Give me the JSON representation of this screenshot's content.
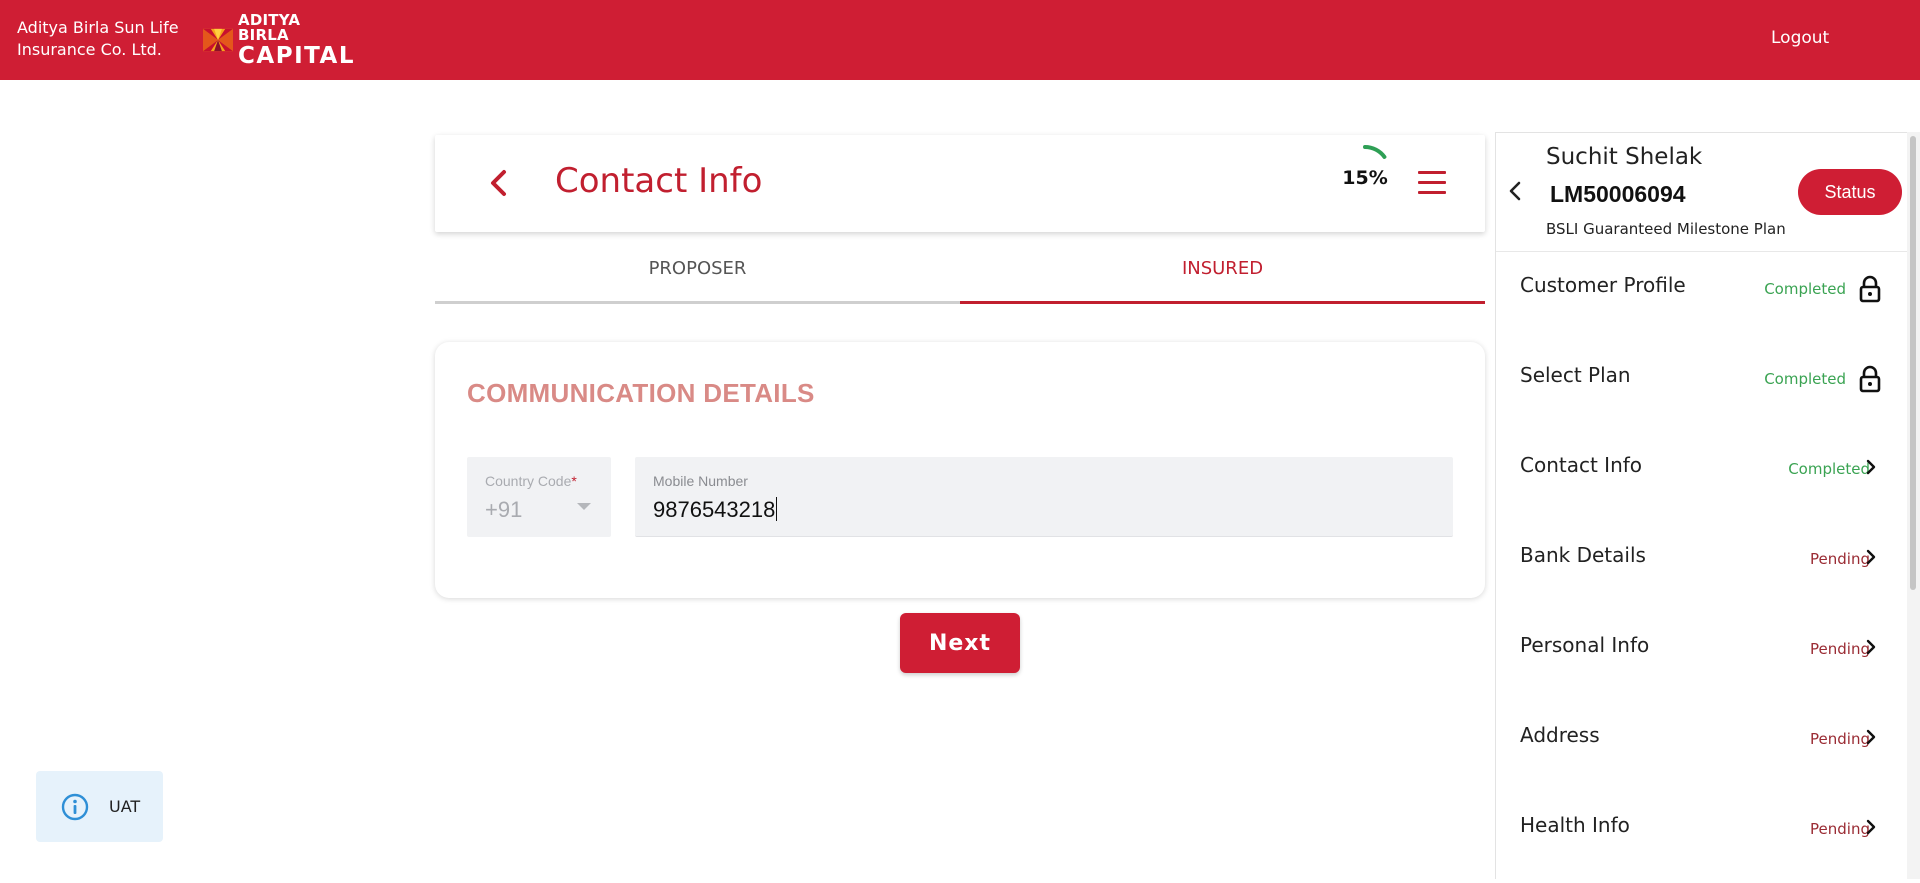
{
  "header": {
    "brand_line1": "Aditya Birla Sun Life",
    "brand_line2": "Insurance Co. Ltd.",
    "logo_line1": "ADITYA BIRLA",
    "logo_line2": "CAPITAL",
    "logout_label": "Logout",
    "bg_color": "#cf1e34"
  },
  "page": {
    "title": "Contact Info",
    "progress_text": "15%",
    "progress_fraction": 0.15
  },
  "tabs": [
    {
      "label": "PROPOSER",
      "active": false
    },
    {
      "label": "INSURED",
      "active": true
    }
  ],
  "communication": {
    "title": "COMMUNICATION DETAILS",
    "country_code_label": "Country Code",
    "country_code_required": "*",
    "country_code_value": "+91",
    "mobile_label": "Mobile Number",
    "mobile_value": "9876543218"
  },
  "next_label": "Next",
  "env_badge": {
    "icon": "info-icon",
    "text": "UAT"
  },
  "customer": {
    "name": "Suchit Shelak",
    "id": "LM50006094",
    "plan": "BSLI Guaranteed Milestone Plan",
    "status_label": "Status"
  },
  "steps": [
    {
      "label": "Customer Profile",
      "status": "Completed",
      "icon": "lock-icon"
    },
    {
      "label": "Select Plan",
      "status": "Completed",
      "icon": "lock-icon"
    },
    {
      "label": "Contact Info",
      "status": "Completed",
      "icon": "chevron-right-icon"
    },
    {
      "label": "Bank Details",
      "status": "Pending",
      "icon": "chevron-right-icon"
    },
    {
      "label": "Personal Info",
      "status": "Pending",
      "icon": "chevron-right-icon"
    },
    {
      "label": "Address",
      "status": "Pending",
      "icon": "chevron-right-icon"
    },
    {
      "label": "Health Info",
      "status": "Pending",
      "icon": "chevron-right-icon"
    }
  ],
  "colors": {
    "accent": "#cf1e34",
    "completed": "#3aa352",
    "pending": "#9a2b33",
    "section_title": "#d98a86"
  }
}
